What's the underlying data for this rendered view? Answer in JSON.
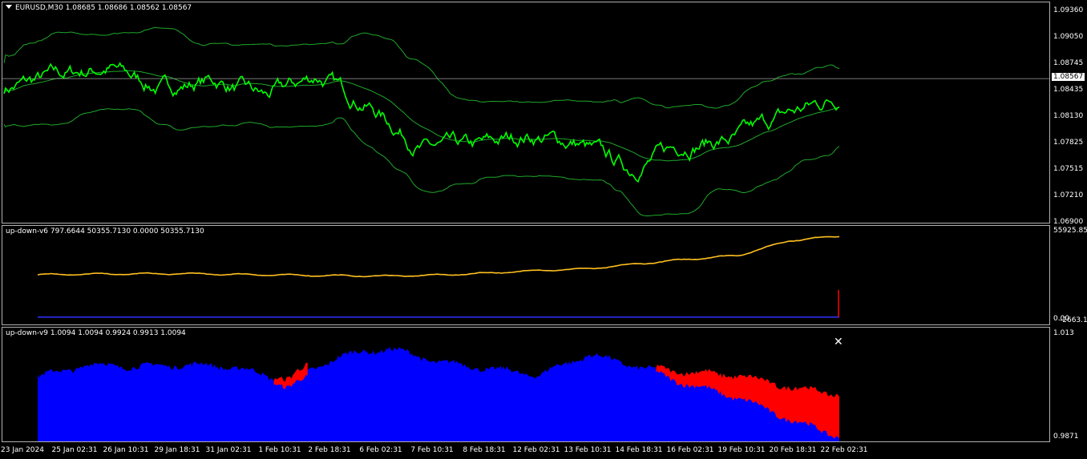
{
  "main": {
    "title": "EURUSD,M30  1.08685 1.08686 1.08562 1.08567",
    "current_price": "1.08567",
    "price_axis": [
      "1.09360",
      "1.09050",
      "1.08745",
      "1.08435",
      "1.08130",
      "1.07825",
      "1.07515",
      "1.07210",
      "1.06900"
    ],
    "colors": {
      "price": "#00ff00",
      "bands": "#1fa82a",
      "current_line": "#a0a0a0"
    }
  },
  "ind1": {
    "title": "up-down-v6 797.6644 50355.7130 0.0000 50355.7130",
    "axis": {
      "top": "55925.858",
      "bottom": "-2663.136",
      "zero": "0.00"
    },
    "colors": {
      "line": "#ffc020",
      "base": "#3030ff",
      "spike": "#ff0000"
    }
  },
  "ind2": {
    "title": "up-down-v9 1.0094 1.0094 0.9924 0.9913 1.0094",
    "axis": {
      "top": "1.013",
      "bottom": "0.9871"
    },
    "colors": {
      "up": "#0000ff",
      "down": "#ff0000",
      "marker": "#ffffff"
    },
    "marker": "✕"
  },
  "time_axis": [
    "23 Jan 2024",
    "25 Jan 02:31",
    "26 Jan 10:31",
    "29 Jan 18:31",
    "31 Jan 02:31",
    "1 Feb 10:31",
    "2 Feb 18:31",
    "6 Feb 02:31",
    "7 Feb 10:31",
    "8 Feb 18:31",
    "12 Feb 02:31",
    "13 Feb 10:31",
    "14 Feb 18:31",
    "16 Feb 02:31",
    "19 Feb 10:31",
    "20 Feb 18:31",
    "22 Feb 02:31"
  ],
  "chart_data": [
    {
      "type": "line",
      "title": "EURUSD,M30",
      "x": [
        "23 Jan 2024",
        "25 Jan 02:31",
        "26 Jan 10:31",
        "29 Jan 18:31",
        "31 Jan 02:31",
        "1 Feb 10:31",
        "2 Feb 18:31",
        "6 Feb 02:31",
        "7 Feb 10:31",
        "8 Feb 18:31",
        "12 Feb 02:31",
        "13 Feb 10:31",
        "14 Feb 18:31",
        "16 Feb 02:31",
        "19 Feb 10:31",
        "20 Feb 18:31",
        "22 Feb 02:31"
      ],
      "series": [
        {
          "values": [
            1.0845,
            1.086,
            1.087,
            1.0845,
            1.0855,
            1.0835,
            1.086,
            1.0825,
            1.0775,
            1.0775,
            1.079,
            1.078,
            1.075,
            1.078,
            1.0785,
            1.0815,
            1.0835
          ]
        }
      ],
      "ylim": [
        1.069,
        1.0936
      ]
    },
    {
      "type": "line",
      "title": "up-down-v6",
      "x": [
        "23 Jan 2024",
        "25 Jan 02:31",
        "26 Jan 10:31",
        "29 Jan 18:31",
        "31 Jan 02:31",
        "1 Feb 10:31",
        "2 Feb 18:31",
        "6 Feb 02:31",
        "7 Feb 10:31",
        "8 Feb 18:31",
        "12 Feb 02:31",
        "13 Feb 10:31",
        "14 Feb 18:31",
        "16 Feb 02:31",
        "19 Feb 10:31",
        "20 Feb 18:31",
        "22 Feb 02:31"
      ],
      "series": [
        {
          "values": [
            27500,
            27800,
            28000,
            28100,
            27600,
            27200,
            26800,
            26600,
            27200,
            28500,
            30200,
            31300,
            34500,
            37500,
            40000,
            49500,
            52500
          ]
        }
      ],
      "ylim": [
        -2663.136,
        55925.858
      ]
    },
    {
      "type": "area",
      "title": "up-down-v9",
      "x": [
        "23 Jan 2024",
        "25 Jan 02:31",
        "26 Jan 10:31",
        "29 Jan 18:31",
        "31 Jan 02:31",
        "1 Feb 10:31",
        "2 Feb 18:31",
        "6 Feb 02:31",
        "7 Feb 10:31",
        "8 Feb 18:31",
        "12 Feb 02:31",
        "13 Feb 10:31",
        "14 Feb 18:31",
        "16 Feb 02:31",
        "19 Feb 10:31",
        "20 Feb 18:31",
        "22 Feb 02:31"
      ],
      "series": [
        {
          "values": [
            1.0025,
            1.0055,
            1.005,
            1.0055,
            1.0048,
            1.001,
            1.0075,
            1.0095,
            1.0062,
            1.0045,
            1.003,
            1.008,
            1.005,
            1.002,
            1.0,
            0.996,
            0.993
          ]
        }
      ],
      "ylim": [
        0.9871,
        1.013
      ]
    }
  ]
}
